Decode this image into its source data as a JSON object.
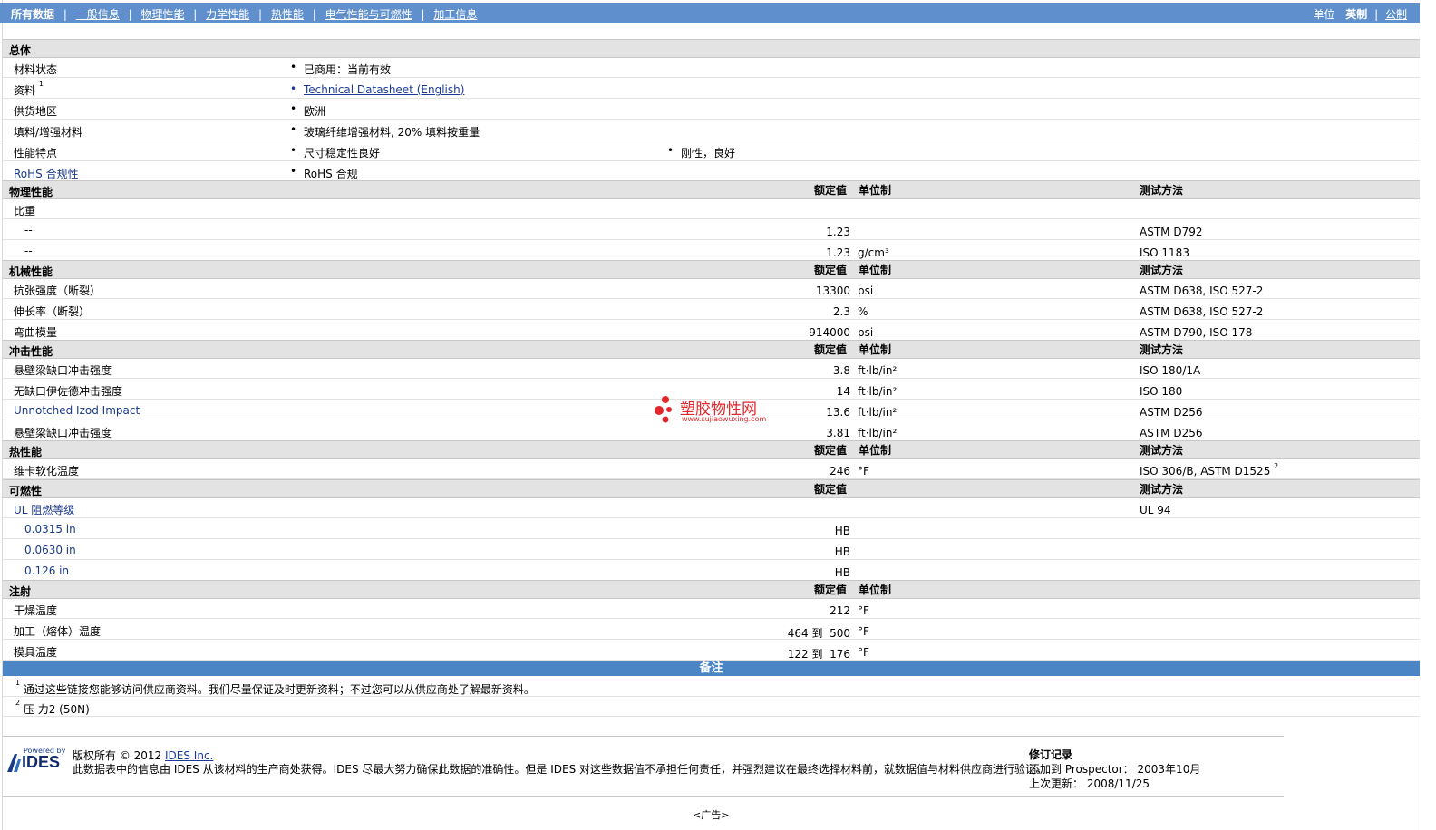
{
  "nav": {
    "items": [
      "所有数据",
      "一般信息",
      "物理性能",
      "力学性能",
      "热性能",
      "电气性能与可燃性",
      "加工信息"
    ],
    "sep": "|"
  },
  "units": {
    "label": "单位",
    "current": "英制",
    "sep": "|",
    "alt": "公制"
  },
  "general": {
    "title": "总体",
    "rows": [
      {
        "label": "材料状态",
        "values": [
          "已商用：当前有效"
        ]
      },
      {
        "label": "资料",
        "sup": "1",
        "values": [
          "Technical Datasheet (English)"
        ]
      },
      {
        "label": "供货地区",
        "values": [
          "欧洲"
        ]
      },
      {
        "label": "填料/增强材料",
        "values": [
          "玻璃纤维增强材料, 20% 填料按重量"
        ]
      },
      {
        "label": "性能特点",
        "values": [
          "尺寸稳定性良好",
          "刚性，良好"
        ]
      },
      {
        "label": "RoHS 合规性",
        "values": [
          "RoHS 合规"
        ]
      }
    ]
  },
  "headers": {
    "nominal": "额定值",
    "unit": "单位制",
    "test": "测试方法"
  },
  "physical": {
    "title": "物理性能",
    "rows": [
      {
        "label": "比重",
        "val": "",
        "unit": "",
        "test": ""
      },
      {
        "label": "--",
        "val": "1.23",
        "unit": "",
        "test": "ASTM D792"
      },
      {
        "label": "--",
        "val": "1.23",
        "unit": "g/cm³",
        "test": "ISO 1183"
      }
    ]
  },
  "mechanical": {
    "title": "机械性能",
    "rows": [
      {
        "label": "抗张强度（断裂）",
        "val": "13300",
        "unit": "psi",
        "test": "ASTM D638, ISO 527-2"
      },
      {
        "label": "伸长率（断裂）",
        "val": "2.3",
        "unit": "%",
        "test": "ASTM D638, ISO 527-2"
      },
      {
        "label": "弯曲模量",
        "val": "914000",
        "unit": "psi",
        "test": "ASTM D790, ISO 178"
      }
    ]
  },
  "impact": {
    "title": "冲击性能",
    "rows": [
      {
        "label": "悬壁梁缺口冲击强度",
        "val": "3.8",
        "unit": "ft·lb/in²",
        "test": "ISO 180/1A"
      },
      {
        "label": "无缺口伊佐德冲击强度",
        "val": "14",
        "unit": "ft·lb/in²",
        "test": "ISO 180"
      },
      {
        "label": "Unnotched Izod Impact",
        "val": "13.6",
        "unit": "ft·lb/in²",
        "test": "ASTM D256"
      },
      {
        "label": "悬壁梁缺口冲击强度",
        "val": "3.81",
        "unit": "ft·lb/in²",
        "test": "ASTM D256"
      }
    ]
  },
  "thermal": {
    "title": "热性能",
    "rows": [
      {
        "label": "维卡软化温度",
        "val": "246",
        "unit": "°F",
        "test": "ISO 306/B, ASTM D1525",
        "sup": "2"
      }
    ]
  },
  "flammability": {
    "title": "可燃性",
    "rows": [
      {
        "label": "UL 阻燃等级",
        "val": "",
        "test": "UL 94"
      },
      {
        "label": "0.0315 in",
        "val": "HB",
        "test": ""
      },
      {
        "label": "0.0630 in",
        "val": "HB",
        "test": ""
      },
      {
        "label": "0.126 in",
        "val": "HB",
        "test": ""
      }
    ]
  },
  "injection": {
    "title": "注射",
    "rows": [
      {
        "label": "干燥温度",
        "val": "212",
        "unit": "°F"
      },
      {
        "label": "加工（熔体）温度",
        "val": "464 到  500",
        "unit": "°F"
      },
      {
        "label": "模具温度",
        "val": "122 到  176",
        "unit": "°F"
      }
    ]
  },
  "notes": {
    "title": "备注",
    "items": [
      {
        "sup": "1",
        "text": "通过这些链接您能够访问供应商资料。我们尽量保证及时更新资料；不过您可以从供应商处了解最新资料。"
      },
      {
        "sup": "2",
        "text": "压  力2 (50N)"
      }
    ]
  },
  "watermark": {
    "name": "塑胶物性网",
    "url": "www.sujiaowuxing.com"
  },
  "footer": {
    "logo_top": "Powered by",
    "logo_name": "IDES",
    "copyright": "版权所有 © 2012",
    "company": "IDES Inc.",
    "disclaimer": "此数据表中的信息由 IDES 从该材料的生产商处获得。IDES 尽最大努力确保此数据的准确性。但是 IDES 对这些数据值不承担任何责任，并强烈建议在最终选择材料前，就数据值与材料供应商进行验证。",
    "rev_title": "修订记录",
    "added_label": "添加到 Prospector：",
    "added_value": "2003年10月",
    "updated_label": "上次更新：",
    "updated_value": "2008/11/25",
    "ad": "<广告>"
  },
  "colors": {
    "bar": "#5f8fcc",
    "notes_bar": "#4b85c6",
    "section_bg": "#e3e3e3",
    "link": "#1a3a9a"
  }
}
